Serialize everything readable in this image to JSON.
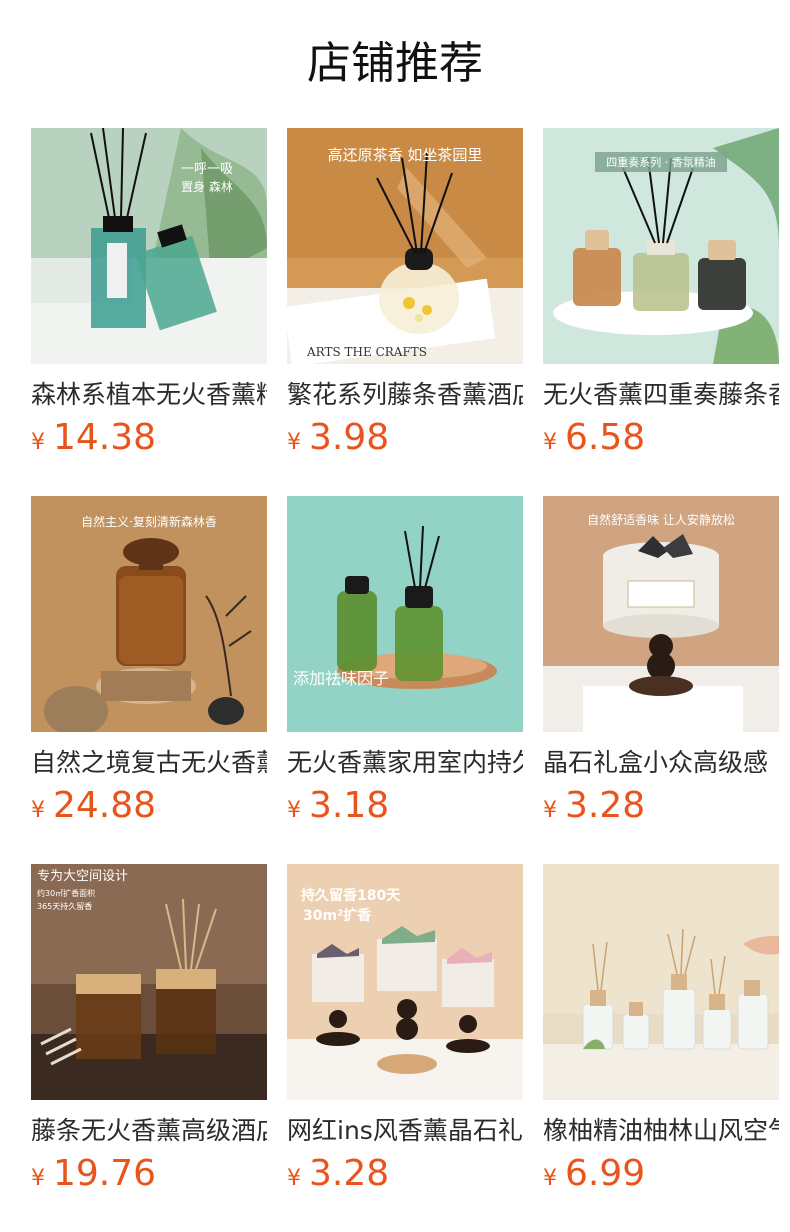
{
  "page": {
    "title": "店铺推荐"
  },
  "colors": {
    "price": "#e8541c",
    "text": "#2b2b2b"
  },
  "products": [
    {
      "name": "森林系植本无火香薰精油",
      "currency": "¥",
      "price": "14.38",
      "image_icon": "reed-diffuser-green-bottles-image",
      "image_text": [
        "一呼一吸",
        "置身 森林"
      ]
    },
    {
      "name": "繁花系列藤条香薰酒店",
      "currency": "¥",
      "price": "3.98",
      "image_icon": "reed-diffuser-flower-jar-image",
      "image_text": [
        "高还原茶香  如坐茶园里",
        "ARTS THE CRAFTS"
      ]
    },
    {
      "name": "无火香薰四重奏藤条香薰",
      "currency": "¥",
      "price": "6.58",
      "image_icon": "reed-diffuser-trio-image",
      "image_text": [
        "四重奏系列 · 香氛精油"
      ]
    },
    {
      "name": "自然之境复古无火香薰",
      "currency": "¥",
      "price": "24.88",
      "image_icon": "amber-bottle-image",
      "image_text": [
        "自然主义·复刻清新森林香"
      ]
    },
    {
      "name": "无火香薰家用室内持久",
      "currency": "¥",
      "price": "3.18",
      "image_icon": "green-reed-bottles-image",
      "image_text": [
        "添加祛味因子"
      ]
    },
    {
      "name": "晶石礼盒小众高级感",
      "currency": "¥",
      "price": "3.28",
      "image_icon": "crystal-stone-diffuser-image",
      "image_text": [
        "自然舒适香味 让人安静放松"
      ]
    },
    {
      "name": "藤条无火香薰高级酒店",
      "currency": "¥",
      "price": "19.76",
      "image_icon": "wood-cap-diffuser-image",
      "image_text": [
        "专为大空间设计",
        "约30㎡扩香面积",
        "365天持久留香"
      ]
    },
    {
      "name": "网红ins风香薰晶石礼盒",
      "currency": "¥",
      "price": "3.28",
      "image_icon": "crystal-stone-trio-image",
      "image_text": [
        "持久留香180天",
        "30m²扩香"
      ]
    },
    {
      "name": "橡柚精油柚林山风空气",
      "currency": "¥",
      "price": "6.99",
      "image_icon": "white-bottles-diffuser-image",
      "image_text": []
    }
  ]
}
